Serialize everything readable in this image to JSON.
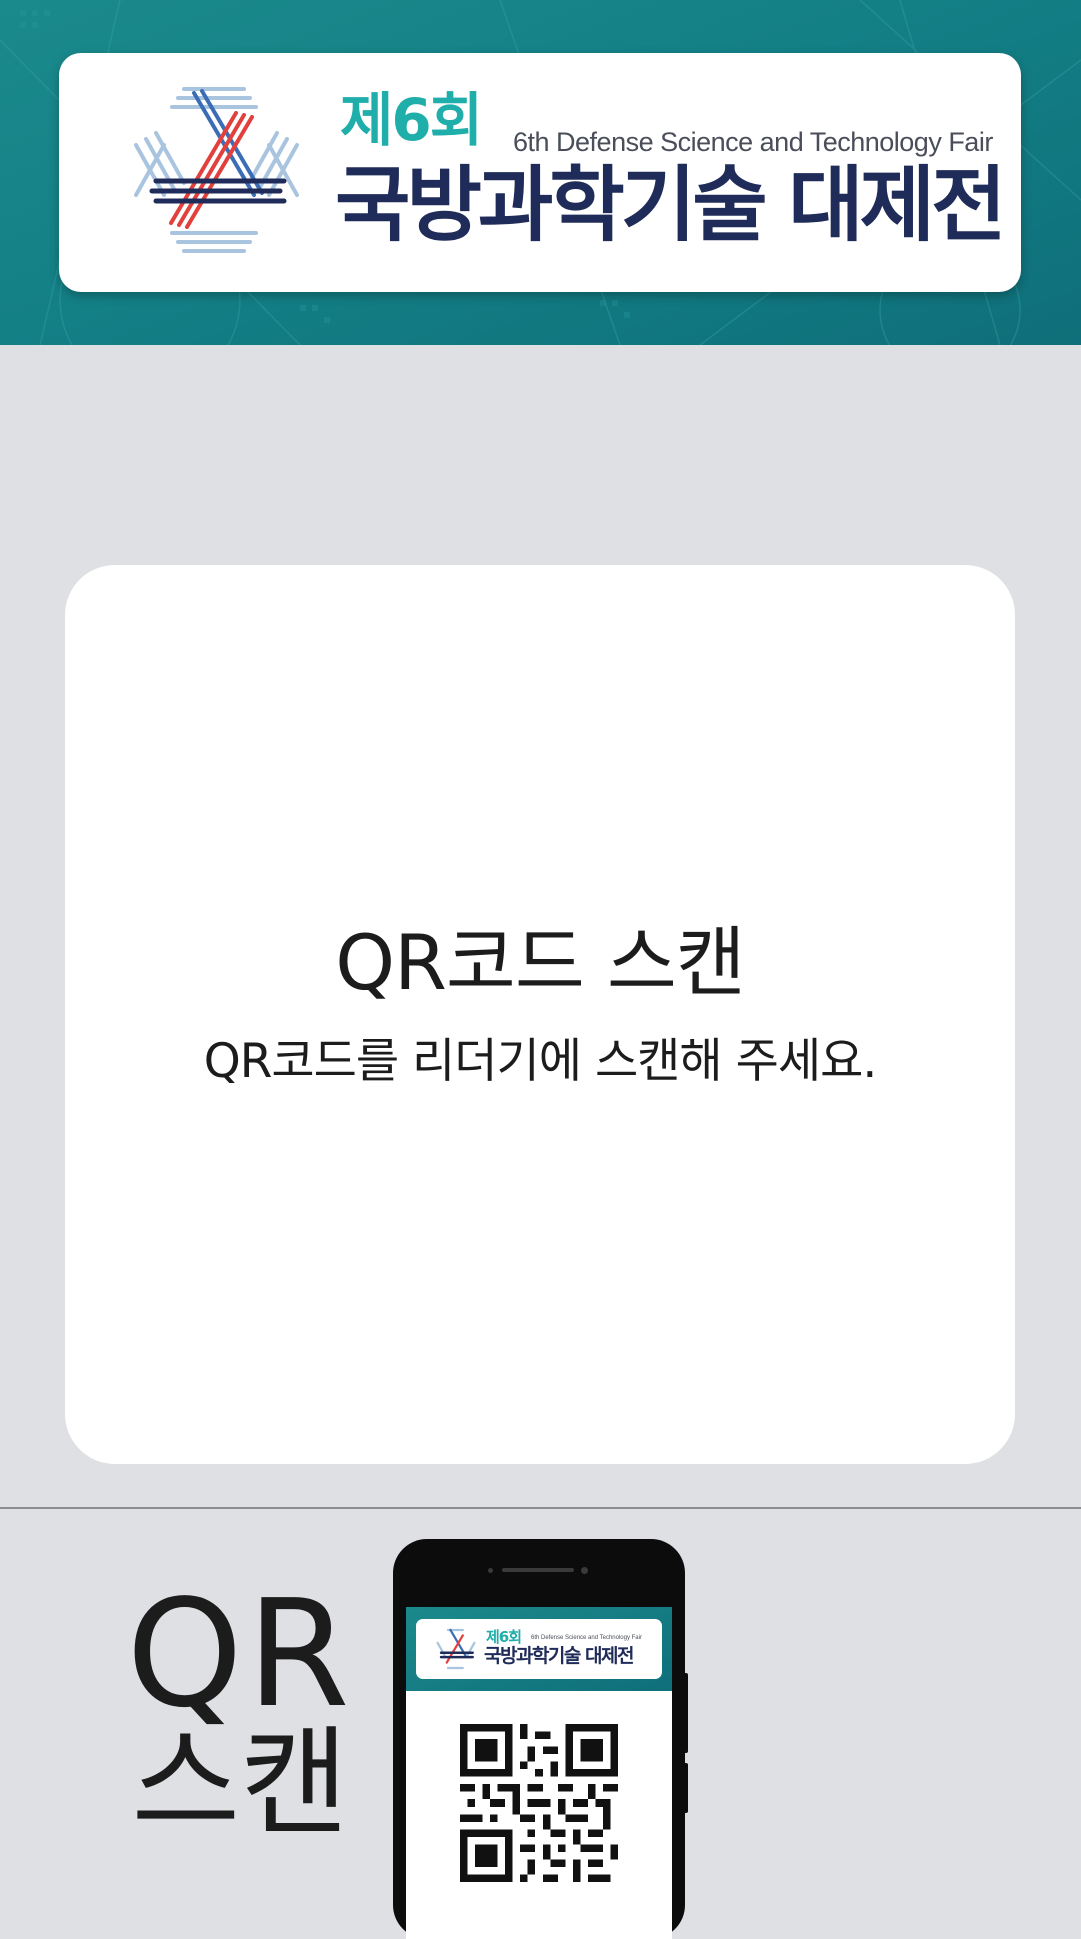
{
  "header": {
    "edition": "제6회",
    "english_title": "6th Defense Science and Technology Fair",
    "korean_title": "국방과학기술 대제전",
    "logo_icon": "snowflake-emblem-icon"
  },
  "main": {
    "title": "QR코드 스캔",
    "description": "QR코드를 리더기에 스캔해 주세요."
  },
  "bottom": {
    "big_label_line1": "QR",
    "big_label_line2": "스캔",
    "phone": {
      "edition": "제6회",
      "english_title": "6th Defense Science and Technology Fair",
      "korean_title": "국방과학기술 대제전",
      "qr_icon": "qr-code-icon"
    }
  },
  "colors": {
    "header_teal": "#138086",
    "accent_teal": "#20aeaa",
    "navy": "#1f2b58",
    "emblem_red": "#e2403c",
    "emblem_light_blue": "#a9c4de",
    "background": "#dfe0e4"
  }
}
